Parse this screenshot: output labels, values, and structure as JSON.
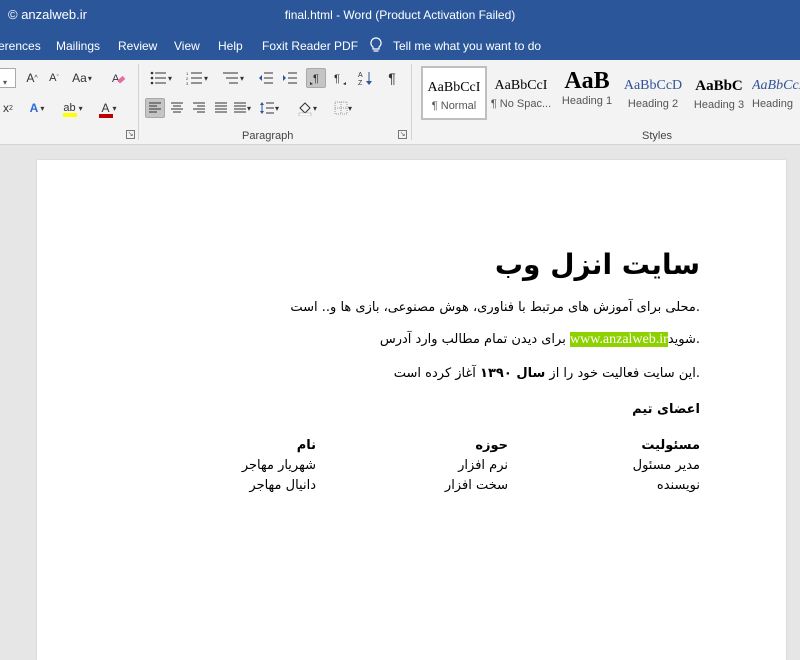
{
  "window": {
    "watermark": "© anzalweb.ir",
    "title": "final.html  -  Word (Product Activation Failed)"
  },
  "menu": {
    "items": [
      "erences",
      "Mailings",
      "Review",
      "View",
      "Help",
      "Foxit Reader PDF"
    ],
    "tell_me": "Tell me what you want to do"
  },
  "ribbon": {
    "font_size_value": "",
    "paragraph_label": "Paragraph",
    "styles_label": "Styles",
    "font_buttons": {
      "grow": "A",
      "shrink": "A",
      "case": "Aa",
      "sub": "x",
      "text_effects": "A",
      "highlight": "ab",
      "font_color": "A"
    },
    "show_marks": "¶",
    "styles": [
      {
        "preview": "AaBbCcI",
        "name": "¶ Normal"
      },
      {
        "preview": "AaBbCcI",
        "name": "¶ No Spac..."
      },
      {
        "preview": "AaB",
        "name": "Heading 1"
      },
      {
        "preview": "AaBbCcD",
        "name": "Heading 2"
      },
      {
        "preview": "AaBbC",
        "name": "Heading 3"
      },
      {
        "preview": "AaBbCcD",
        "name": "Heading"
      }
    ],
    "colors": {
      "highlight": "#ffff00",
      "font_color": "#c00000"
    }
  },
  "document": {
    "heading": "سایت انزل وب",
    "para1": ".محلی برای آموزش های مرتبط با فناوری، هوش مصنوعی، بازی ها و.. است",
    "para2_prefix": ".شوید",
    "para2_link": "www.anzalweb.ir",
    "para2_suffix": " برای دیدن تمام مطالب وارد آدرس",
    "para3_prefix": ".این سایت فعالیت خود را از ",
    "para3_bold": "سال ۱۳۹۰",
    "para3_suffix": " آغاز کرده است",
    "team_heading": "اعضای تیم",
    "table": {
      "headers": [
        "مسئولیت",
        "حوزه",
        "نام"
      ],
      "rows": [
        [
          "مدیر مسئول",
          "نرم افزار",
          "شهریار مهاجر"
        ],
        [
          "نویسنده",
          "سخت افزار",
          "دانیال مهاجر"
        ]
      ]
    }
  }
}
